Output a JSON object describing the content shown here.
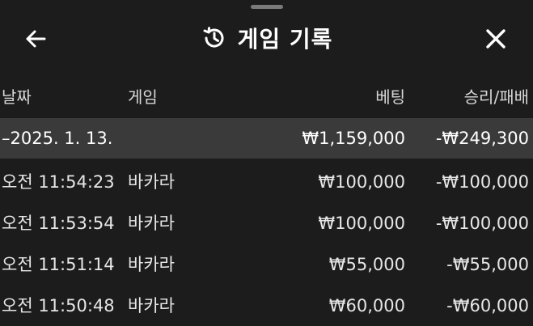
{
  "header": {
    "title": "게임 기록",
    "back_icon": "arrow-left-icon",
    "history_icon": "history-icon",
    "close_icon": "close-icon"
  },
  "columns": {
    "date": "날짜",
    "game": "게임",
    "bet": "베팅",
    "result": "승리/패배"
  },
  "summary": {
    "date": "–2025. 1. 13.",
    "game": "",
    "bet": "₩1,159,000",
    "result": "-₩249,300"
  },
  "rows": [
    {
      "time": "오전 11:54:23",
      "game": "바카라",
      "bet": "₩100,000",
      "result": "-₩100,000"
    },
    {
      "time": "오전 11:53:54",
      "game": "바카라",
      "bet": "₩100,000",
      "result": "-₩100,000"
    },
    {
      "time": "오전 11:51:14",
      "game": "바카라",
      "bet": "₩55,000",
      "result": "-₩55,000"
    },
    {
      "time": "오전 11:50:48",
      "game": "바카라",
      "bet": "₩60,000",
      "result": "-₩60,000"
    }
  ],
  "colors": {
    "background": "#1c1c1c",
    "summary_row": "#3a3a3a",
    "text": "#e6e6e6"
  }
}
